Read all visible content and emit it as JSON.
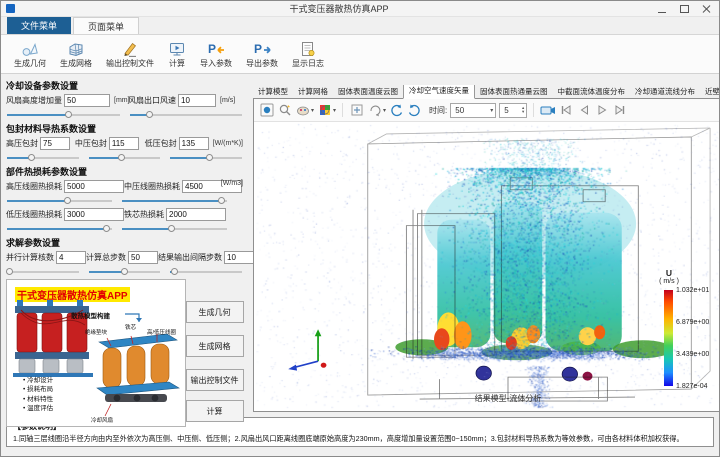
{
  "window": {
    "title": "干式变压器散热仿真APP"
  },
  "menu_tabs": [
    {
      "label": "文件菜单"
    },
    {
      "label": "页面菜单"
    }
  ],
  "toolbar": {
    "items": [
      {
        "label": "生成几何",
        "icon": "geometry-icon"
      },
      {
        "label": "生成网格",
        "icon": "mesh-icon"
      },
      {
        "label": "输出控制文件",
        "icon": "control-file-icon"
      },
      {
        "label": "计算",
        "icon": "compute-icon"
      },
      {
        "label": "导入参数",
        "icon": "import-params-icon"
      },
      {
        "label": "导出参数",
        "icon": "export-params-icon"
      },
      {
        "label": "显示日志",
        "icon": "show-log-icon"
      }
    ]
  },
  "params": {
    "section1": {
      "title": "冷却设备参数设置",
      "fields": [
        {
          "label": "风扇高度增加量",
          "value": "50",
          "unit": "[mm]"
        },
        {
          "label": "风扇出口风速",
          "value": "10",
          "unit": "[m/s]"
        }
      ]
    },
    "section2": {
      "title": "包封材料导热系数设置",
      "unit": "[W/(m*K)]",
      "fields": [
        {
          "label": "高压包封",
          "value": "75"
        },
        {
          "label": "中压包封",
          "value": "115"
        },
        {
          "label": "低压包封",
          "value": "135"
        }
      ]
    },
    "section3": {
      "title": "部件热损耗参数设置",
      "unit": "[W/m3]",
      "fields": [
        {
          "label": "高压线圈热损耗",
          "value": "5000"
        },
        {
          "label": "中压线圈热损耗",
          "value": "4500"
        },
        {
          "label": "低压线圈热损耗",
          "value": "3000"
        },
        {
          "label": "铁芯热损耗",
          "value": "2000"
        }
      ]
    },
    "section4": {
      "title": "求解参数设置",
      "fields": [
        {
          "label": "并行计算核数",
          "value": "4"
        },
        {
          "label": "计算总步数",
          "value": "50"
        },
        {
          "label": "结果输出间隔步数",
          "value": "10"
        }
      ]
    }
  },
  "illustration": {
    "title": "干式变压器散热仿真APP",
    "flow_label": "散热模型构建",
    "bullets": [
      "冷却设计",
      "损耗布局",
      "材料特性",
      "温度评估"
    ],
    "part_labels": {
      "pad": "绝缘垫块",
      "core": "铁芯",
      "coils": "高/低压线圈",
      "fan": "冷却风扇"
    }
  },
  "action_buttons": [
    {
      "label": "生成几何"
    },
    {
      "label": "生成网格"
    },
    {
      "label": "输出控制文件"
    },
    {
      "label": "计算"
    }
  ],
  "view_tabs": [
    {
      "label": "计算模型"
    },
    {
      "label": "计算网格"
    },
    {
      "label": "固体表面温度云图"
    },
    {
      "label": "冷却空气速度矢量",
      "active": true
    },
    {
      "label": "固体表面热通量云图"
    },
    {
      "label": "中截面流体温度分布"
    },
    {
      "label": "冷却通道流线分布"
    },
    {
      "label": "近壁流体温度分布"
    }
  ],
  "plot_toolbar": {
    "time_label": "时间:",
    "time_value": "50",
    "frame_value": "5"
  },
  "plot": {
    "caption": "结果模型-流体分析",
    "colorbar": {
      "title": "U",
      "unit": "( m/s )",
      "ticks": [
        "1.032e+01",
        "6.879e+00",
        "3.439e+00",
        "1.827e-04"
      ],
      "color_top": "#c3001d",
      "color_bottom": "#1306e8"
    }
  },
  "footer": {
    "title": "【参数说明】",
    "text": "1.同轴三层线圈沿半径方向由内至外依次为高压侧、中压侧、低压侧；2.风扇出风口距离线圈底端原始高度为230mm，高度增加量设置范围0~150mm；3.包封材料导热系数为等效参数，可由各材料体积加权获得。"
  }
}
